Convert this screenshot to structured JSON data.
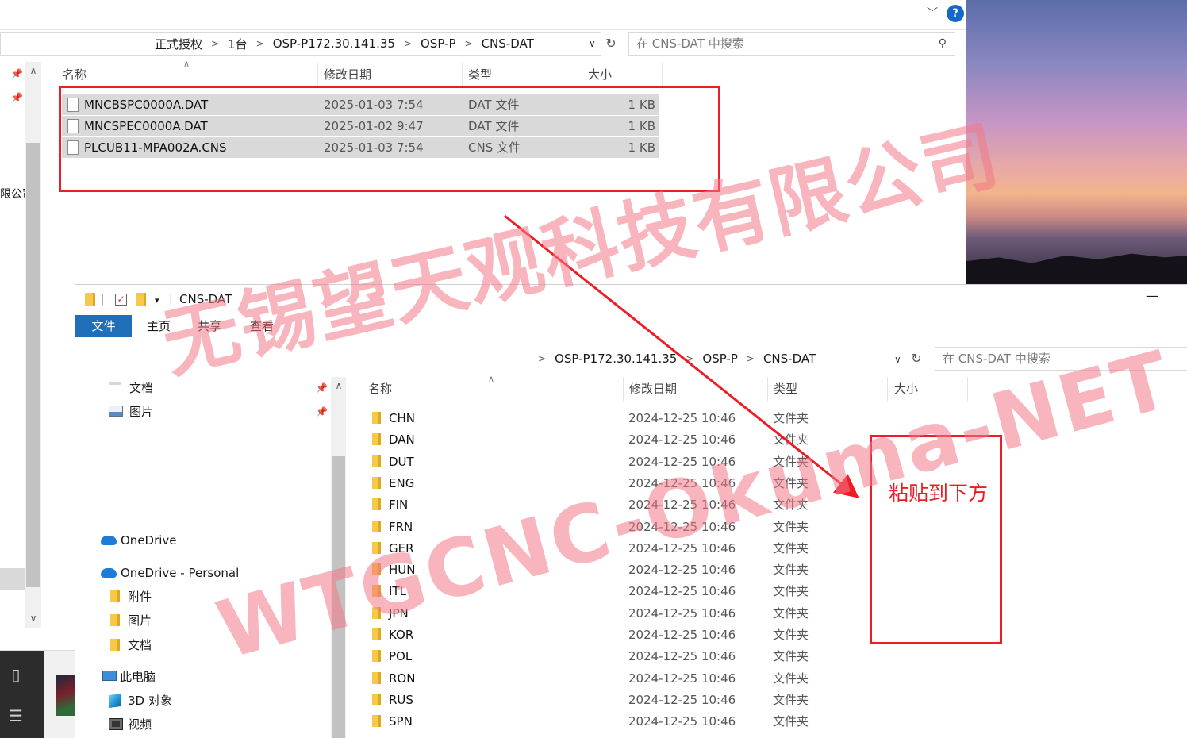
{
  "top_window": {
    "breadcrumb": [
      "正式授权",
      "1台",
      "OSP-P172.30.141.35",
      "OSP-P",
      "CNS-DAT"
    ],
    "search_placeholder": "在 CNS-DAT 中搜索",
    "left_nav_cut_text": "限公司",
    "columns": {
      "name": "名称",
      "date": "修改日期",
      "type": "类型",
      "size": "大小"
    },
    "files": [
      {
        "name": "MNCBSPC0000A.DAT",
        "date": "2025-01-03 7:54",
        "type": "DAT 文件",
        "size": "1 KB"
      },
      {
        "name": "MNCSPEC0000A.DAT",
        "date": "2025-01-02 9:47",
        "type": "DAT 文件",
        "size": "1 KB"
      },
      {
        "name": "PLCUB11-MPA002A.CNS",
        "date": "2025-01-03 7:54",
        "type": "CNS 文件",
        "size": "1 KB"
      }
    ]
  },
  "bottom_window": {
    "title": "CNS-DAT",
    "ribbon_tabs": [
      "文件",
      "主页",
      "共享",
      "查看"
    ],
    "breadcrumb": [
      "OSP-P172.30.141.35",
      "OSP-P",
      "CNS-DAT"
    ],
    "search_placeholder": "在 CNS-DAT 中搜索",
    "nav_tree": {
      "quick": [
        {
          "label": "文档",
          "icon": "document-icon"
        },
        {
          "label": "图片",
          "icon": "picture-icon"
        }
      ],
      "onedrive": "OneDrive",
      "onedrive_personal": "OneDrive - Personal",
      "onedrive_children": [
        "附件",
        "图片",
        "文档"
      ],
      "this_pc": "此电脑",
      "pc_children": [
        {
          "label": "3D 对象",
          "icon": "3d-objects-icon"
        },
        {
          "label": "视频",
          "icon": "video-icon"
        }
      ]
    },
    "columns": {
      "name": "名称",
      "date": "修改日期",
      "type": "类型",
      "size": "大小"
    },
    "folders": [
      {
        "name": "CHN",
        "date": "2024-12-25 10:46",
        "type": "文件夹"
      },
      {
        "name": "DAN",
        "date": "2024-12-25 10:46",
        "type": "文件夹"
      },
      {
        "name": "DUT",
        "date": "2024-12-25 10:46",
        "type": "文件夹"
      },
      {
        "name": "ENG",
        "date": "2024-12-25 10:46",
        "type": "文件夹"
      },
      {
        "name": "FIN",
        "date": "2024-12-25 10:46",
        "type": "文件夹"
      },
      {
        "name": "FRN",
        "date": "2024-12-25 10:46",
        "type": "文件夹"
      },
      {
        "name": "GER",
        "date": "2024-12-25 10:46",
        "type": "文件夹"
      },
      {
        "name": "HUN",
        "date": "2024-12-25 10:46",
        "type": "文件夹"
      },
      {
        "name": "ITL",
        "date": "2024-12-25 10:46",
        "type": "文件夹"
      },
      {
        "name": "JPN",
        "date": "2024-12-25 10:46",
        "type": "文件夹"
      },
      {
        "name": "KOR",
        "date": "2024-12-25 10:46",
        "type": "文件夹"
      },
      {
        "name": "POL",
        "date": "2024-12-25 10:46",
        "type": "文件夹"
      },
      {
        "name": "RON",
        "date": "2024-12-25 10:46",
        "type": "文件夹"
      },
      {
        "name": "RUS",
        "date": "2024-12-25 10:46",
        "type": "文件夹"
      },
      {
        "name": "SPN",
        "date": "2024-12-25 10:46",
        "type": "文件夹"
      }
    ]
  },
  "annotation": {
    "paste_label": "粘贴到下方",
    "color": "#ee1c25"
  },
  "watermark": {
    "chinese": "无锡望天观科技有限公司",
    "english": "WTGCNC-Okuma-NET",
    "color": "#f27887"
  },
  "colors": {
    "ribbon_active": "#1f6fb8",
    "selection": "#d9d9d9",
    "help": "#1567c9"
  }
}
